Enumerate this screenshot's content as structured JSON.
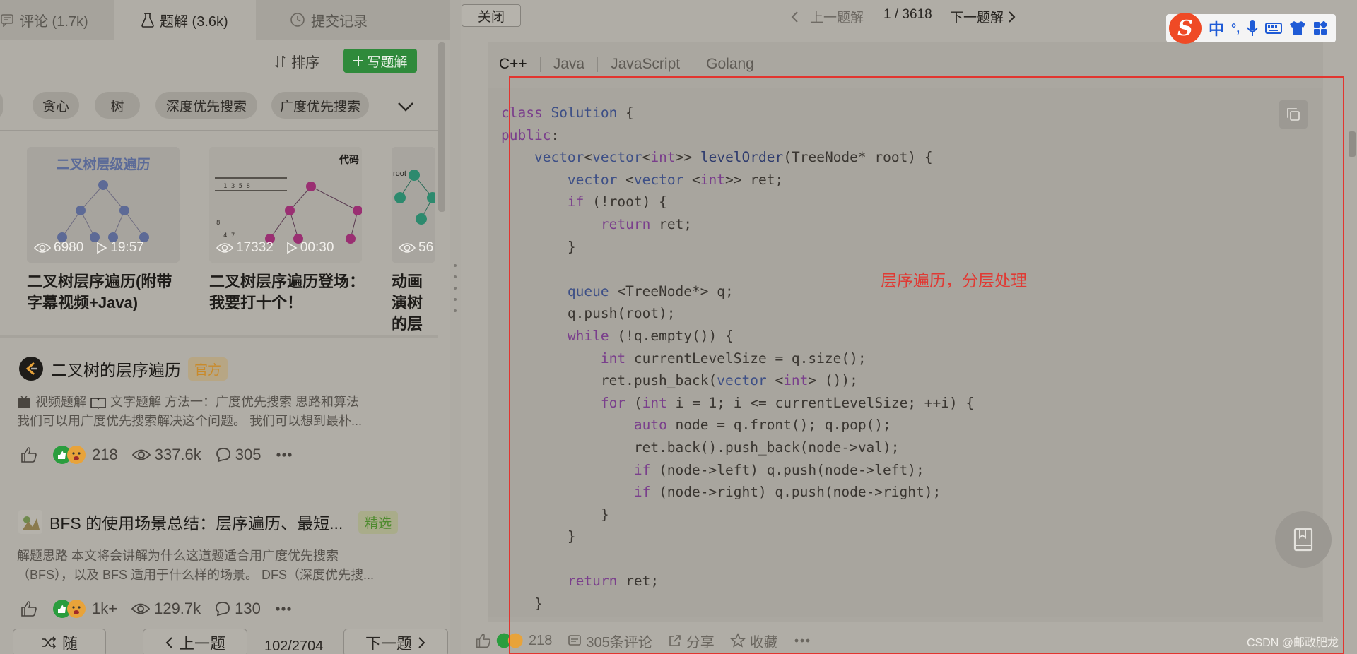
{
  "left_tabs": [
    {
      "label": "评论 (1.7k)",
      "icon": "comment-icon"
    },
    {
      "label": "题解 (3.6k)",
      "icon": "flask-icon"
    },
    {
      "label": "提交记录",
      "icon": "clock-icon"
    }
  ],
  "toolbar": {
    "sort_label": "排序",
    "write_label": "写题解"
  },
  "tags": [
    "",
    "贪心",
    "树",
    "深度优先搜索",
    "广度优先搜索"
  ],
  "videos": [
    {
      "thumb_title": "二叉树层级遍历",
      "views": "6980",
      "duration": "19:57",
      "title": "二叉树层序遍历(附带字幕视频+Java)"
    },
    {
      "thumb_text": "代码",
      "views": "17332",
      "duration": "00:30",
      "title": "二叉树层序遍历登场：我要打十个！"
    },
    {
      "thumb_text": "root",
      "views": "56",
      "duration": "",
      "title": "动画演树的层"
    }
  ],
  "solutions": [
    {
      "title": "二叉树的层序遍历",
      "badge": "官方",
      "desc_line1_a": "视频题解",
      "desc_line1_b": "文字题解 方法一：广度优先搜索 思路和算法",
      "desc_line2": "我们可以用广度优先搜索解决这个问题。 我们可以想到最朴...",
      "likes": "218",
      "views": "337.6k",
      "comments": "305"
    },
    {
      "title": "BFS 的使用场景总结：层序遍历、最短...",
      "badge": "精选",
      "desc_line1": "解题思路 本文将会讲解为什么这道题适合用广度优先搜索",
      "desc_line2": "（BFS），以及 BFS 适用于什么样的场景。 DFS（深度优先搜...",
      "likes": "1k+",
      "views": "129.7k",
      "comments": "130"
    }
  ],
  "bottom_left": {
    "random": "随",
    "prev": "上一题",
    "page": "102/2704",
    "next": "下一题"
  },
  "right_top": {
    "close": "关闭",
    "prev": "上一题解",
    "count": "1 / 3618",
    "next": "下一题解"
  },
  "ime": {
    "logo": "S",
    "mode": "中",
    "punct": "°,"
  },
  "languages": [
    "C++",
    "Java",
    "JavaScript",
    "Golang"
  ],
  "code_lines": [
    "class Solution {",
    "public:",
    "    vector<vector<int>> levelOrder(TreeNode* root) {",
    "        vector <vector <int>> ret;",
    "        if (!root) {",
    "            return ret;",
    "        }",
    "",
    "        queue <TreeNode*> q;",
    "        q.push(root);",
    "        while (!q.empty()) {",
    "            int currentLevelSize = q.size();",
    "            ret.push_back(vector <int> ());",
    "            for (int i = 1; i <= currentLevelSize; ++i) {",
    "                auto node = q.front(); q.pop();",
    "                ret.back().push_back(node->val);",
    "                if (node->left) q.push(node->left);",
    "                if (node->right) q.push(node->right);",
    "            }",
    "        }",
    "",
    "        return ret;",
    "    }"
  ],
  "annotation": "层序遍历，分层处理",
  "right_bottom": {
    "likes": "218",
    "comments": "305条评论",
    "share": "分享",
    "favorite": "收藏"
  },
  "watermark": "CSDN @邮政肥龙",
  "colors": {
    "green": "#2f8a3b",
    "red_annotation": "#e03a34",
    "official_badge": "#c98a2a",
    "featured_badge": "#4e8a2e"
  }
}
